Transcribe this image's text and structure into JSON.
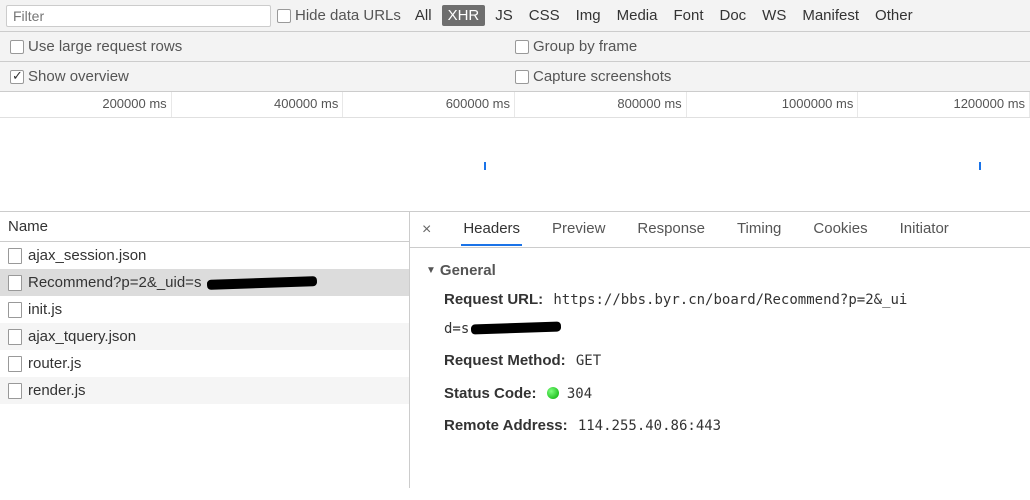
{
  "toolbar": {
    "filter_placeholder": "Filter",
    "hide_data_urls": "Hide data URLs",
    "types": [
      "All",
      "XHR",
      "JS",
      "CSS",
      "Img",
      "Media",
      "Font",
      "Doc",
      "WS",
      "Manifest",
      "Other"
    ],
    "active_type": "XHR"
  },
  "options": {
    "large_rows": "Use large request rows",
    "show_overview": "Show overview",
    "group_by_frame": "Group by frame",
    "capture_screenshots": "Capture screenshots"
  },
  "timeline": {
    "ticks": [
      "200000 ms",
      "400000 ms",
      "600000 ms",
      "800000 ms",
      "1000000 ms",
      "1200000 ms"
    ]
  },
  "requests": {
    "header": "Name",
    "items": [
      {
        "name": "ajax_session.json"
      },
      {
        "name": "Recommend?p=2&_uid=s",
        "redacted": true,
        "selected": true
      },
      {
        "name": "init.js"
      },
      {
        "name": "ajax_tquery.json"
      },
      {
        "name": "router.js"
      },
      {
        "name": "render.js"
      }
    ]
  },
  "detail": {
    "tabs": [
      "Headers",
      "Preview",
      "Response",
      "Timing",
      "Cookies",
      "Initiator"
    ],
    "active_tab": "Headers",
    "general_label": "General",
    "request_url_label": "Request URL:",
    "request_url_value_prefix": "https://bbs.byr.cn/board/Recommend?p=2&_ui",
    "request_url_value_line2": "d=s",
    "request_method_label": "Request Method:",
    "request_method_value": "GET",
    "status_code_label": "Status Code:",
    "status_code_value": "304",
    "remote_address_label": "Remote Address:",
    "remote_address_value": "114.255.40.86:443"
  }
}
